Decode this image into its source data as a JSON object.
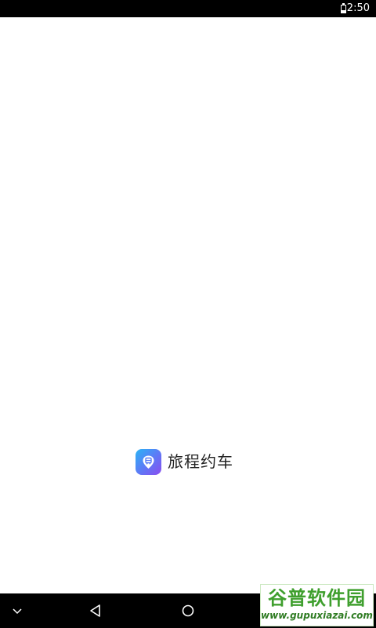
{
  "status_bar": {
    "time": "2:50",
    "battery_icon": "battery-icon"
  },
  "splash": {
    "app_icon": "bus-location-icon",
    "app_name": "旅程约车",
    "icon_gradient": [
      "#2ab4f5",
      "#5b7cf6",
      "#8a4cf0"
    ]
  },
  "nav_bar": {
    "hide_icon": "chevron-down-icon",
    "back_icon": "back-triangle-icon",
    "home_icon": "home-circle-icon"
  },
  "watermark": {
    "brand": "谷普软件园",
    "url": "www.gupuxiazai.com"
  }
}
